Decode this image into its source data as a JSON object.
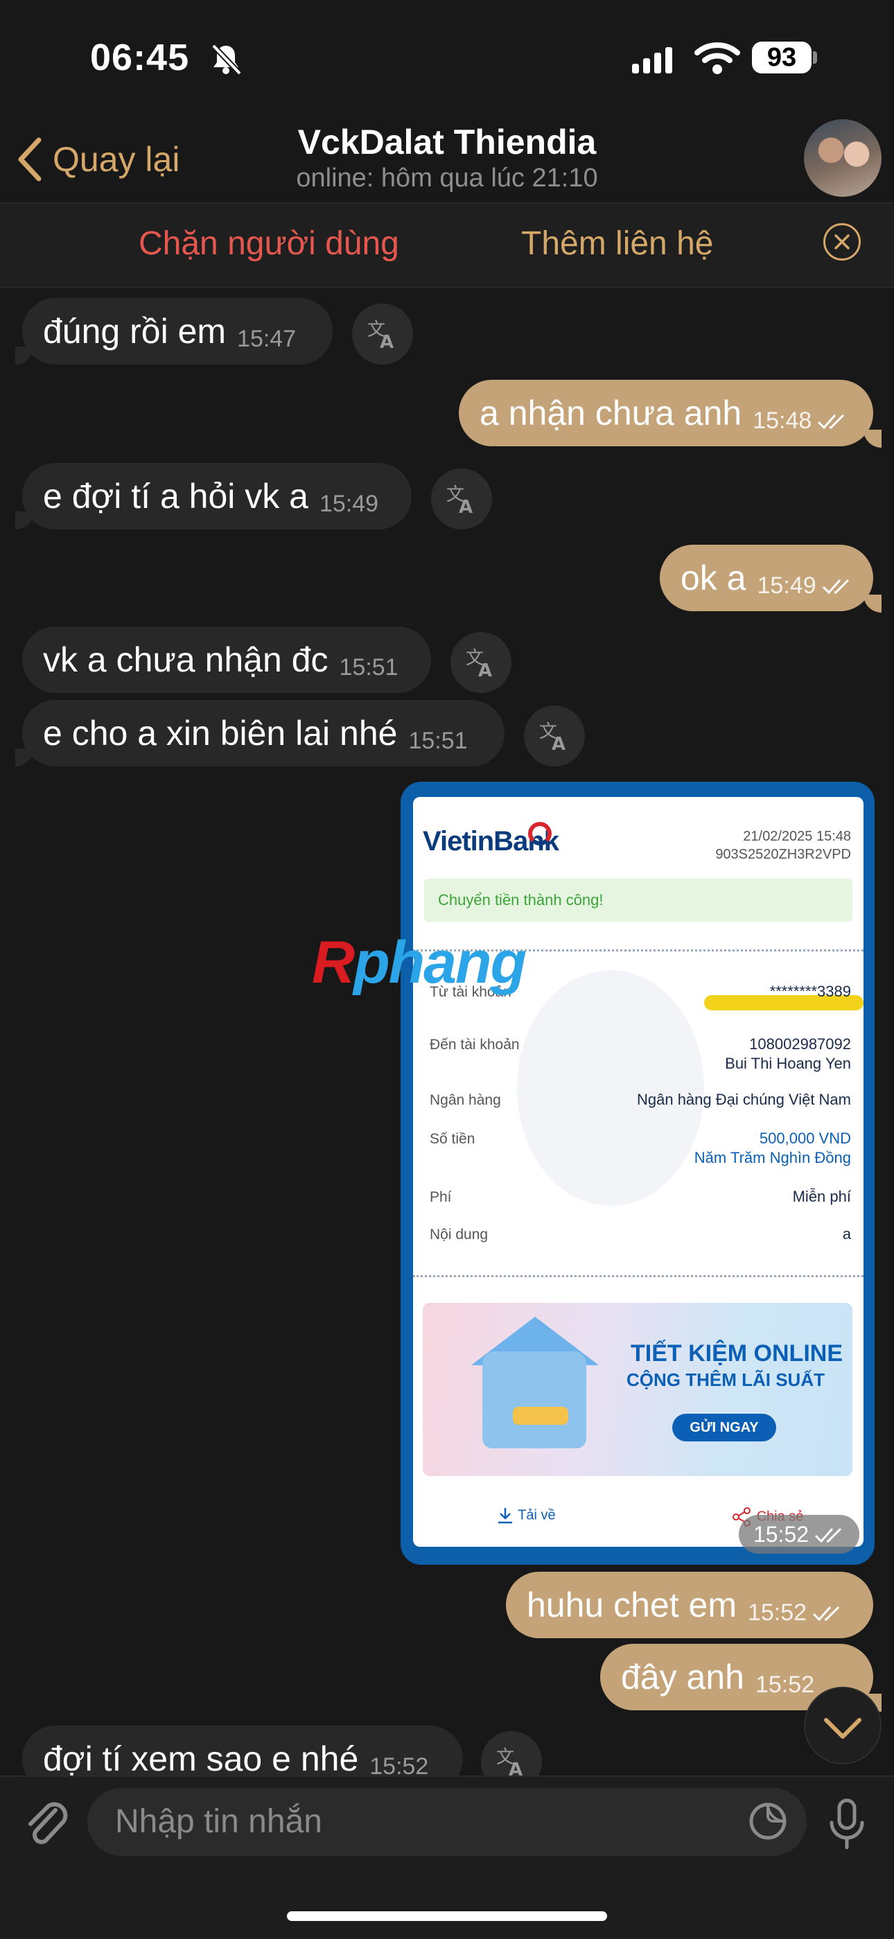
{
  "status_bar": {
    "time": "06:45",
    "battery": "93"
  },
  "header": {
    "back_label": "Quay lại",
    "title": "VckDalat Thiendia",
    "subtitle": "online: hôm qua lúc 21:10"
  },
  "action_bar": {
    "block_label": "Chặn người dùng",
    "add_contact_label": "Thêm liên hệ"
  },
  "messages": [
    {
      "side": "in",
      "text": "đúng rồi em",
      "time": "15:47"
    },
    {
      "side": "out",
      "text": "a nhận chưa anh",
      "time": "15:48"
    },
    {
      "side": "in",
      "text": "e đợi tí a hỏi vk a",
      "time": "15:49"
    },
    {
      "side": "out",
      "text": "ok a",
      "time": "15:49"
    },
    {
      "side": "in",
      "text": "vk a chưa nhận đc",
      "time": "15:51"
    },
    {
      "side": "in",
      "text": "e cho a xin biên lai nhé",
      "time": "15:51"
    },
    {
      "side": "out",
      "text": "huhu chet em",
      "time": "15:52"
    },
    {
      "side": "out",
      "text": "đây anh",
      "time": "15:52"
    },
    {
      "side": "in",
      "text": "đợi tí xem sao e nhé",
      "time": "15:52"
    }
  ],
  "receipt": {
    "bank_logo": "VietinBank",
    "datetime": "21/02/2025 15:48",
    "code": "903S2520ZH3R2VPD",
    "success": "Chuyển tiền thành công!",
    "rows": [
      {
        "label": "Từ tài khoản",
        "value": "********3389"
      },
      {
        "label": "Đến tài khoản",
        "value": "108002987092",
        "value2": "Bui Thi Hoang Yen"
      },
      {
        "label": "Ngân hàng",
        "value": "Ngân hàng Đại chúng Việt Nam"
      },
      {
        "label": "Số tiền",
        "value": "500,000 VND",
        "value2": "Năm Trăm Nghìn Đồng"
      },
      {
        "label": "Phí",
        "value": "Miễn phí"
      },
      {
        "label": "Nội dung",
        "value": "a"
      }
    ],
    "promo_title": "TIẾT KIỆM ONLINE",
    "promo_subtitle": "CỘNG THÊM LÃI SUẤT",
    "promo_button": "GỬI NGAY",
    "download_label": "Tải về",
    "share_label": "Chia sẻ",
    "sent_time": "15:52"
  },
  "watermark": {
    "r": "R",
    "rest": "phang"
  },
  "composer": {
    "placeholder": "Nhập tin nhắn"
  },
  "colors": {
    "accent": "#d5a86a",
    "outgoing_bubble": "#c4a378",
    "incoming_bubble": "#282828",
    "danger": "#e5574f"
  }
}
